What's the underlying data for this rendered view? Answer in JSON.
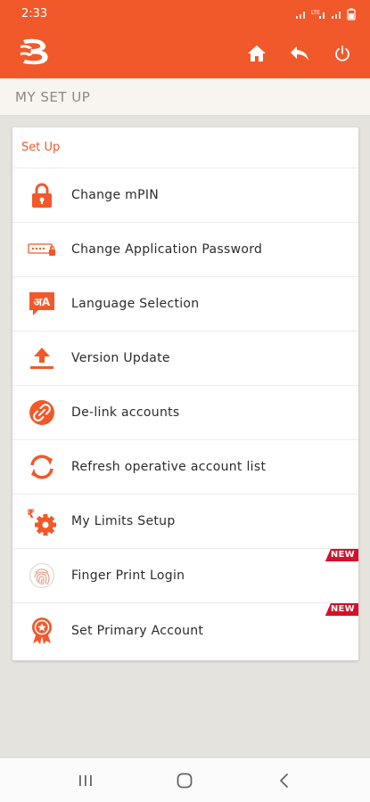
{
  "status_bar": {
    "time": "2:33",
    "icons": [
      "signal-icon",
      "lte-icon",
      "signal-icon",
      "battery-icon"
    ]
  },
  "app_bar": {
    "logo": "bank-of-baroda-logo",
    "actions": [
      "home-icon",
      "back-icon",
      "power-icon"
    ]
  },
  "page_header": {
    "title": "MY SET UP"
  },
  "section": {
    "title": "Set Up"
  },
  "menu_items": [
    {
      "label": "Change mPIN",
      "icon": "lock-icon",
      "badge": ""
    },
    {
      "label": "Change Application Password",
      "icon": "password-icon",
      "badge": ""
    },
    {
      "label": "Language Selection",
      "icon": "language-icon",
      "badge": ""
    },
    {
      "label": "Version Update",
      "icon": "upload-icon",
      "badge": ""
    },
    {
      "label": "De-link accounts",
      "icon": "link-icon",
      "badge": ""
    },
    {
      "label": "Refresh operative account list",
      "icon": "refresh-icon",
      "badge": ""
    },
    {
      "label": "My Limits Setup",
      "icon": "limits-gear-icon",
      "badge": ""
    },
    {
      "label": "Finger Print Login",
      "icon": "fingerprint-icon",
      "badge": "NEW"
    },
    {
      "label": "Set Primary Account",
      "icon": "award-icon",
      "badge": "NEW"
    }
  ],
  "language_icon_text": "अA",
  "colors": {
    "accent": "#f1592a",
    "badge": "#d3112a"
  },
  "nav_bar": [
    "recent-apps-icon",
    "home-circle-icon",
    "back-chevron-icon"
  ]
}
